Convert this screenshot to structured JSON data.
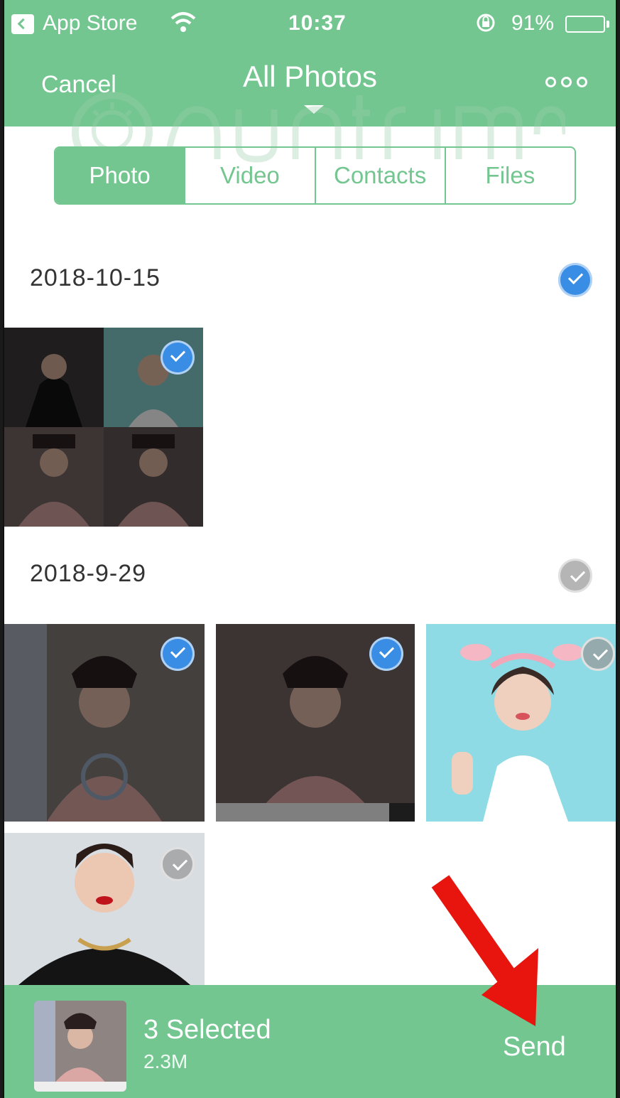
{
  "status_bar": {
    "carrier": "App Store",
    "time": "10:37",
    "battery": "91%",
    "battery_level": 0.91
  },
  "nav": {
    "cancel_label": "Cancel",
    "title": "All Photos"
  },
  "tabs": [
    {
      "label": "Photo",
      "active": true
    },
    {
      "label": "Video",
      "active": false
    },
    {
      "label": "Contacts",
      "active": false
    },
    {
      "label": "Files",
      "active": false
    }
  ],
  "sections": [
    {
      "date": "2018-10-15",
      "all_selected": true
    },
    {
      "date": "2018-9-29",
      "all_selected": false
    }
  ],
  "bottom_bar": {
    "selected_count": "3 Selected",
    "total_size": "2.3M",
    "send_label": "Send"
  },
  "colors": {
    "accent": "#74c690",
    "check_on": "#3a8de4",
    "arrow": "#e8150f"
  },
  "watermark": "Quantrimang"
}
